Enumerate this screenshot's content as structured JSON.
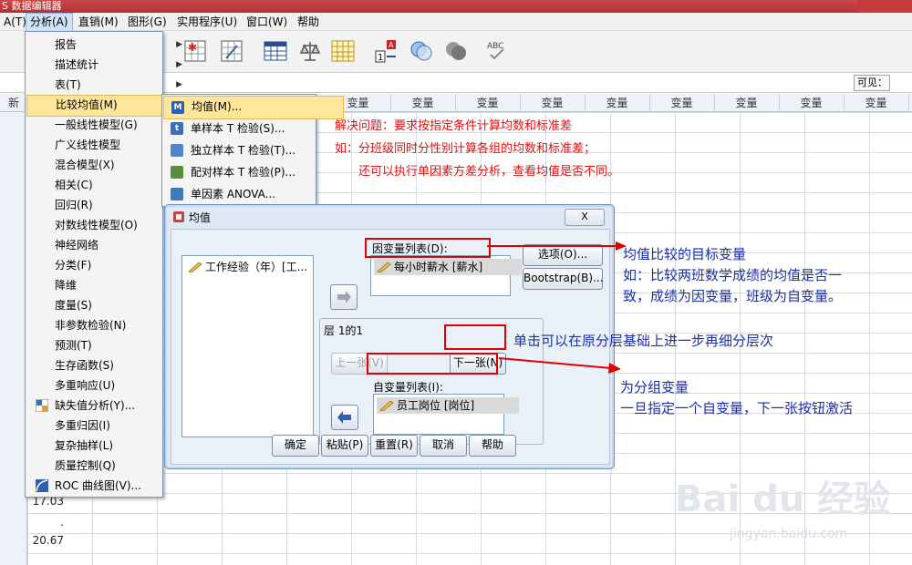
{
  "window": {
    "title": "S 数据编辑器"
  },
  "menubar": [
    {
      "label": "A(T)"
    },
    {
      "label": "分析(A)"
    },
    {
      "label": "直销(M)"
    },
    {
      "label": "图形(G)"
    },
    {
      "label": "实用程序(U)"
    },
    {
      "label": "窗口(W)"
    },
    {
      "label": "帮助"
    }
  ],
  "toolbar": {
    "icons": [
      "split-file-icon",
      "weight-cases-icon",
      "table-icon",
      "balance-icon",
      "grid-icon",
      "value-labels-icon",
      "circles-icon",
      "gray-circles-icon",
      "spellcheck-icon"
    ]
  },
  "editrow": {
    "visible_label": "可见："
  },
  "grid": {
    "first_col_partial": "新",
    "column_headers": [
      "变量",
      "变量",
      "变量",
      "变量",
      "变量",
      "变量",
      "变量",
      "变量",
      "变量",
      "变量",
      "变量"
    ],
    "visible_values": [
      "17.03",
      ".",
      "20.67"
    ]
  },
  "analyze_menu": {
    "items": [
      {
        "label": "报告",
        "submenu": true
      },
      {
        "label": "描述统计",
        "submenu": true
      },
      {
        "label": "表(T)",
        "submenu": true
      },
      {
        "label": "比较均值(M)",
        "submenu": true,
        "highlighted": true
      },
      {
        "label": "一般线性模型(G)",
        "submenu": true
      },
      {
        "label": "广义线性模型",
        "submenu": true
      },
      {
        "label": "混合模型(X)",
        "submenu": true
      },
      {
        "label": "相关(C)",
        "submenu": true
      },
      {
        "label": "回归(R)",
        "submenu": true
      },
      {
        "label": "对数线性模型(O)",
        "submenu": true
      },
      {
        "label": "神经网络",
        "submenu": true
      },
      {
        "label": "分类(F)",
        "submenu": true
      },
      {
        "label": "降维",
        "submenu": true
      },
      {
        "label": "度量(S)",
        "submenu": true
      },
      {
        "label": "非参数检验(N)",
        "submenu": true
      },
      {
        "label": "预测(T)",
        "submenu": true
      },
      {
        "label": "生存函数(S)",
        "submenu": true
      },
      {
        "label": "多重响应(U)",
        "submenu": true
      },
      {
        "label": "缺失值分析(Y)...",
        "submenu": false,
        "icon": "missing-values-icon"
      },
      {
        "label": "多重归因(I)",
        "submenu": true
      },
      {
        "label": "复杂抽样(L)",
        "submenu": true
      },
      {
        "label": "质量控制(Q)",
        "submenu": true
      },
      {
        "label": "ROC 曲线图(V)...",
        "submenu": false,
        "icon": "roc-curve-icon"
      }
    ]
  },
  "compare_submenu": {
    "items": [
      {
        "label": "均值(M)...",
        "icon_text": "M",
        "color": "#2f5fb3",
        "highlighted": true
      },
      {
        "label": "单样本 T 检验(S)...",
        "icon_text": "t",
        "color": "#3b6fb8"
      },
      {
        "label": "独立样本 T 检验(T)...",
        "icon_text": "",
        "color": "#4d86c9"
      },
      {
        "label": "配对样本 T 检验(P)...",
        "icon_text": "",
        "color": "#5a8f3a"
      },
      {
        "label": "单因素 ANOVA...",
        "icon_text": "",
        "color": "#3d7ab8"
      }
    ]
  },
  "dialog": {
    "title": "均值",
    "close_label": "X",
    "source_list": [
      "工作经验（年）[工..."
    ],
    "dependent_label": "因变量列表(D):",
    "dependent_items": [
      "每小时薪水 [薪水]"
    ],
    "layer_label": "层 1的1",
    "prev_label": "上一张(V)",
    "next_label": "下一张(N)",
    "independent_label": "自变量列表(I):",
    "independent_items": [
      "员工岗位 [岗位]"
    ],
    "options_label": "选项(O)...",
    "bootstrap_label": "Bootstrap(B)...",
    "buttons": [
      "确定",
      "粘贴(P)",
      "重置(R)",
      "取消",
      "帮助"
    ]
  },
  "annotations": {
    "red_line1": "解决问题：要求按指定条件计算均数和标准差",
    "red_line2": "如：分班级同时分性别计算各组的均数和标准差；",
    "red_line3": "还可以执行单因素方差分析，查看均值是否不同。",
    "dep_title": "均值比较的目标变量",
    "dep_line1": "如：比较两班数学成绩的均值是否一",
    "dep_line2": "致，成绩为因变量，班级为自变量。",
    "next_note": "单击可以在原分层基础上进一步再细分层次",
    "indep_title": "为分组变量",
    "indep_line": "一旦指定一个自变量，下一张按钮激活"
  },
  "watermark": {
    "text": "Bai du 经验",
    "url": "jingyan.baidu.com"
  },
  "colors": {
    "highlight": "#ffe69a",
    "annotation_red": "#e01010",
    "annotation_blue": "#1a2fa8",
    "dialog_bg": "#dfe9f5"
  }
}
